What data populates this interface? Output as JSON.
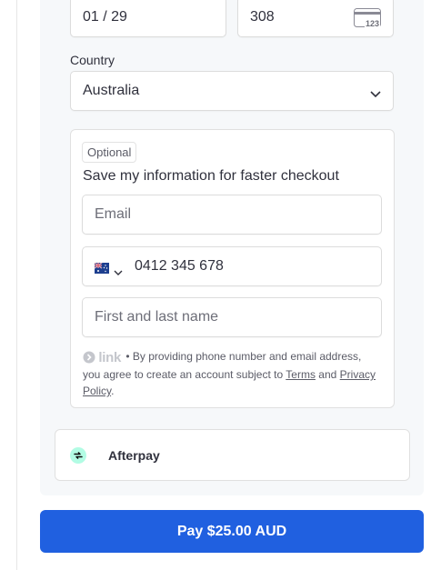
{
  "card": {
    "expiry_value": "01 / 29",
    "cvc_value": "308",
    "cvc_icon": "card-cvc-icon",
    "cvc_icon_text": "123"
  },
  "country": {
    "label": "Country",
    "value": "Australia"
  },
  "link_save": {
    "optional_badge": "Optional",
    "heading": "Save my information for faster checkout",
    "email_placeholder": "Email",
    "phone_country_flag": "australia-flag-icon",
    "phone_value": "0412 345 678",
    "name_placeholder": "First and last name",
    "link_logo": "link",
    "disclaimer_text": "• By providing phone number and email address, you agree to create an account subject to",
    "terms_link": "Terms",
    "and_text": "and",
    "privacy_link": "Privacy Policy",
    "period": "."
  },
  "afterpay": {
    "label": "Afterpay",
    "icon": "afterpay-icon"
  },
  "pay_button": {
    "label": "Pay $25.00 AUD"
  },
  "colors": {
    "pay_button_bg": "#2060e0",
    "afterpay_accent": "#b2fce4"
  }
}
